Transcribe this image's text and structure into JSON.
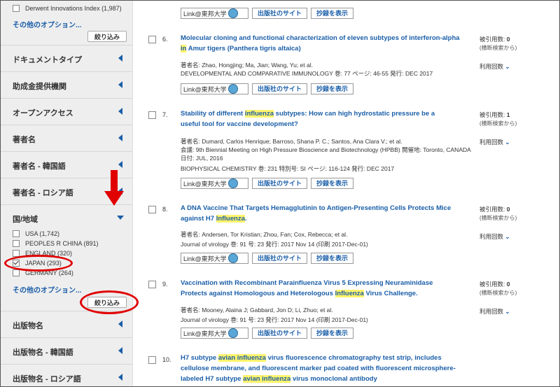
{
  "sidebar": {
    "top_option": {
      "label": "Derwent Innovations Index (1,987)",
      "checked": false
    },
    "more_options_1": "その他のオプション...",
    "refine_1": "絞り込み",
    "facets_top": [
      {
        "label": "ドキュメントタイプ"
      },
      {
        "label": "助成金提供機関"
      },
      {
        "label": "オープンアクセス"
      },
      {
        "label": "著者名"
      },
      {
        "label": "著者名 - 韓国語"
      },
      {
        "label": "著者名 - ロシア語"
      }
    ],
    "country_facet": {
      "label": "国/地域",
      "options": [
        {
          "label": "USA (1,742)",
          "checked": false
        },
        {
          "label": "PEOPLES R CHINA (891)",
          "checked": false
        },
        {
          "label": "ENGLAND (320)",
          "checked": false
        },
        {
          "label": "JAPAN (293)",
          "checked": true
        },
        {
          "label": "GERMANY (264)",
          "checked": false
        }
      ],
      "more_options": "その他のオプション...",
      "refine": "絞り込み"
    },
    "facets_bottom": [
      {
        "label": "出版物名"
      },
      {
        "label": "出版物名 - 韓国語"
      },
      {
        "label": "出版物名 - ロシア語"
      }
    ]
  },
  "buttons": {
    "link_badge": "Link@東邦大学",
    "publisher": "出版社のサイト",
    "abstract": "抄録を表示"
  },
  "citation": {
    "label": "被引用数",
    "sub": "(横断検索から)",
    "usage": "利用回数",
    "chevron": "⌄"
  },
  "records": [
    {
      "num": "6.",
      "title_parts": [
        "Molecular cloning and functional characterization of eleven subtypes of interferon-alpha ",
        "in",
        " Amur tigers (Panthera tigris altaica)"
      ],
      "authors": "著者名: Zhao, Hongjing; Ma, Jian; Wang, Yu; et al.",
      "source": "DEVELOPMENTAL AND COMPARATIVE IMMUNOLOGY  巻: 77  ページ: 46-55  発行: DEC 2017",
      "cites": "0"
    },
    {
      "num": "7.",
      "title_parts": [
        "Stability of different ",
        "influenza",
        " subtypes: How can high hydrostatic pressure be a useful tool for vaccine development?"
      ],
      "authors": "著者名: Dumard, Carlos Henrique; Barroso, Shana P. C.; Santos, Ana Clara V.; et al.",
      "conference": "会議: 9th Biennial Meeting on High Pressure Bioscience and Biotechnology (HPBB) 開催地: Toronto, CANADA 日付: JUL, 2016",
      "source": "BIOPHYSICAL CHEMISTRY  巻: 231  特別号: SI  ページ: 116-124  発行: DEC 2017",
      "cites": "1"
    },
    {
      "num": "8.",
      "title_parts": [
        "A DNA Vaccine That Targets Hemagglutinin to Antigen-Presenting Cells Protects Mice against H7 ",
        "Influenza",
        "."
      ],
      "authors": "著者名: Andersen, Tor Kristian; Zhou, Fan; Cox, Rebecca; et al.",
      "source": "Journal of virology  巻: 91  号: 23      発行: 2017 Nov 14 (印刷 2017-Dec-01)",
      "cites": "0"
    },
    {
      "num": "9.",
      "title_parts": [
        "Vaccination with Recombinant Parainfluenza Virus 5 Expressing Neuraminidase Protects against Homologous and Heterologous ",
        "Influenza",
        " Virus Challenge."
      ],
      "authors": "著者名: Mooney, Alaina J; Gabbard, Jon D; Li, Zhuo; et al.",
      "source": "Journal of virology  巻: 91  号: 23      発行: 2017 Nov 14 (印刷 2017-Dec-01)",
      "cites": "0"
    },
    {
      "num": "10.",
      "title_parts": [
        "H7 subtype ",
        "avian influenza",
        " virus fluorescence chromatography test strip, includes cellulose membrane, and fluorescent marker pad coated with fluorescent microsphere-labeled H7 subtype ",
        "avian influenza",
        " virus monoclonal antibody"
      ]
    }
  ],
  "colors": {
    "link": "#1a5ea8",
    "highlight": "#fff46b",
    "annotation": "#e00000",
    "sidebar_bg": "#eeeeee"
  }
}
